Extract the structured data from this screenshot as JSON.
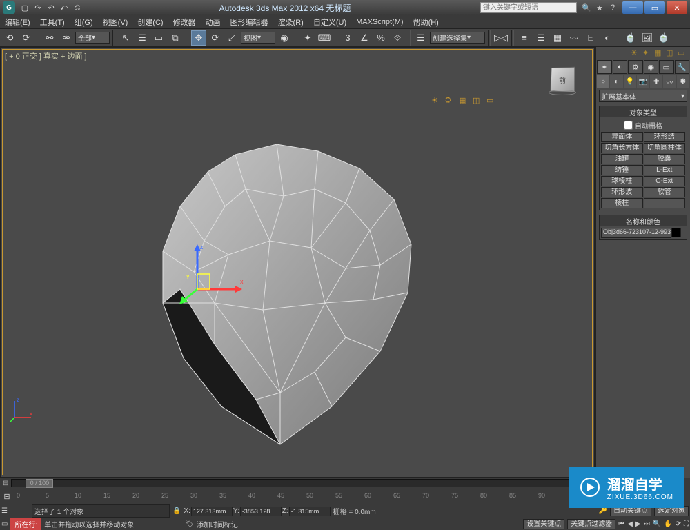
{
  "title": "Autodesk 3ds Max 2012 x64   无标题",
  "searchPlaceholder": "键入关键字或短语",
  "menu": [
    "编辑(E)",
    "工具(T)",
    "组(G)",
    "视图(V)",
    "创建(C)",
    "修改器",
    "动画",
    "图形编辑器",
    "渲染(R)",
    "自定义(U)",
    "MAXScript(M)",
    "帮助(H)"
  ],
  "layerLabel": "全部",
  "viewLabel": "视图",
  "createSetLabel": "创建选择集",
  "viewportLabel": "[ + 0 正交 ] 真实 + 边面 ]",
  "cubeFace": "前",
  "cmdDropdown": "扩展基本体",
  "rollouts": {
    "objType": "对象类型",
    "autoGrid": "自动栅格",
    "nameColor": "名称和颜色"
  },
  "objButtons": [
    "异面体",
    "环形结",
    "切角长方体",
    "切角圆柱体",
    "油罐",
    "胶囊",
    "纺锤",
    "L-Ext",
    "球棱柱",
    "C-Ext",
    "环形波",
    "软管",
    "棱柱",
    ""
  ],
  "objectName": "Obj3d66-723107-12-993",
  "timeThumb": "0 / 100",
  "ticks": [
    "0",
    "5",
    "10",
    "15",
    "20",
    "25",
    "30",
    "35",
    "40",
    "45",
    "50",
    "55",
    "60",
    "65",
    "70",
    "75",
    "80",
    "85",
    "90"
  ],
  "status": {
    "selected": "选择了 1 个对象",
    "x": "127.313mm",
    "y": "-3853.128",
    "z": "-1.315mm",
    "grid": "栅格 = 0.0mm",
    "autoKey": "自动关键点",
    "selSet": "选定对象",
    "prompt": "单击并拖动以选择并移动对象",
    "addTag": "添加时间标记",
    "setKey": "设置关键点",
    "keyFilter": "关键点过滤器",
    "nowTag": "所在行:"
  },
  "gizmoAxes": {
    "x": "x",
    "y": "y",
    "z": "z"
  },
  "watermark": {
    "main": "溜溜自学",
    "sub": "ZIXUE.3D66.COM"
  }
}
